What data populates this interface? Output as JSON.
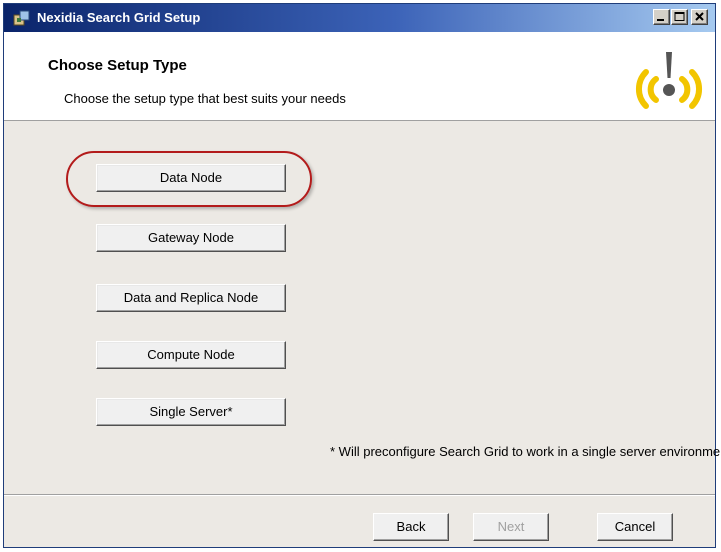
{
  "window": {
    "title": "Nexidia Search Grid Setup"
  },
  "header": {
    "title": "Choose Setup Type",
    "subtitle": "Choose the setup type that best suits your needs",
    "logo_icon": "nexidia-broadcast-icon"
  },
  "setup_options": [
    {
      "label": "Data Node",
      "highlighted": true
    },
    {
      "label": "Gateway Node"
    },
    {
      "label": "Data and Replica Node"
    },
    {
      "label": "Compute Node"
    },
    {
      "label": "Single Server*"
    }
  ],
  "note": "* Will preconfigure Search Grid to work in a single server environment.",
  "footer": {
    "back_label": "Back",
    "next_label": "Next",
    "cancel_label": "Cancel",
    "next_enabled": false
  },
  "colors": {
    "titlebar": "#0a246a",
    "highlight_ring": "#b31b1b",
    "logo_yellow": "#f2c500"
  }
}
